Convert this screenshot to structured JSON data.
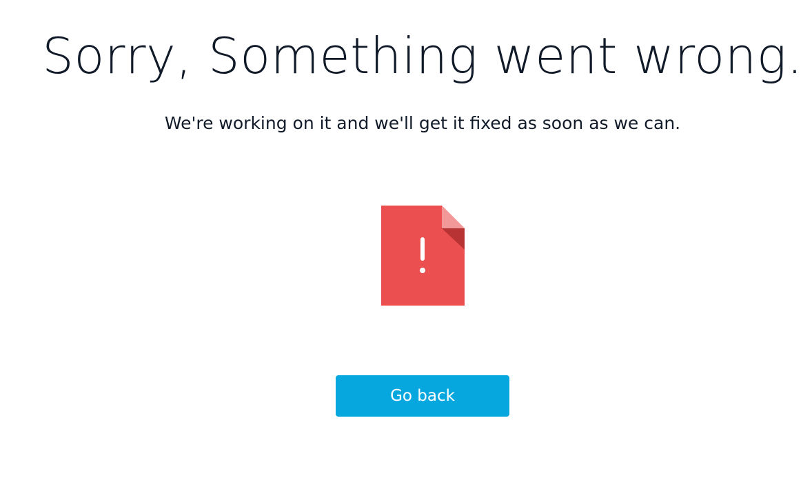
{
  "error_page": {
    "title": "Sorry, Something went wrong.",
    "message": "We're working on it and we'll get it fixed as soon as we can.",
    "icon": "error-document-icon",
    "go_back_label": "Go back"
  },
  "colors": {
    "button_bg": "#06a7de",
    "icon_red": "#eb4f4f",
    "icon_fold_light": "#f29898",
    "icon_fold_dark": "#b83334"
  }
}
